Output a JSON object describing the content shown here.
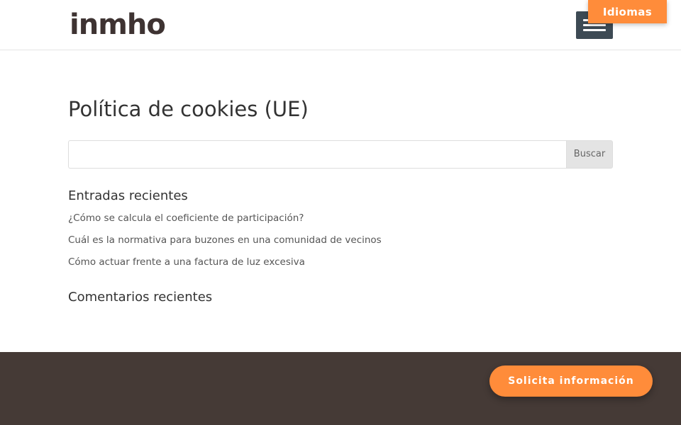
{
  "header": {
    "logo_text": "inmho",
    "menu_icon": "hamburger-menu-icon",
    "language_button_label": "Idiomas"
  },
  "main": {
    "page_title": "Política de cookies (UE)",
    "search": {
      "value": "",
      "placeholder": "",
      "button_label": "Buscar"
    },
    "recent_posts": {
      "title": "Entradas recientes",
      "items": [
        "¿Cómo se calcula el coeficiente de participación?",
        "Cuál es la normativa para buzones en una comunidad de vecinos",
        "Cómo actuar frente a una factura de luz excesiva"
      ]
    },
    "recent_comments": {
      "title": "Comentarios recientes"
    }
  },
  "footer": {
    "cta_label": "Solicita información"
  },
  "colors": {
    "accent": "#ff8c3a",
    "logo": "#3e3332",
    "menu_button": "#3d4a54",
    "footer_background": "#453a36"
  }
}
